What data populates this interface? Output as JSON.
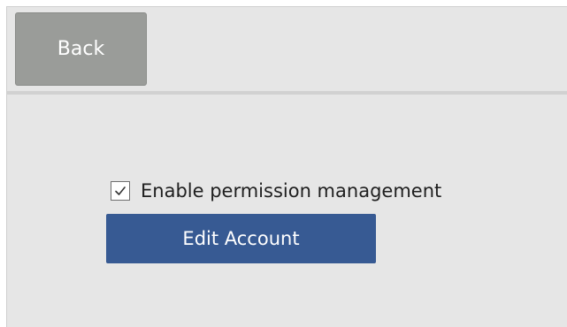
{
  "header": {
    "back_label": "Back"
  },
  "permissions": {
    "checkbox_label": "Enable permission management",
    "checked": true
  },
  "actions": {
    "edit_account_label": "Edit Account"
  },
  "colors": {
    "panel_background": "#e6e6e6",
    "back_button": "#9a9c99",
    "primary_button": "#375a93"
  },
  "icons": {
    "checkbox": "checkmark-icon"
  }
}
